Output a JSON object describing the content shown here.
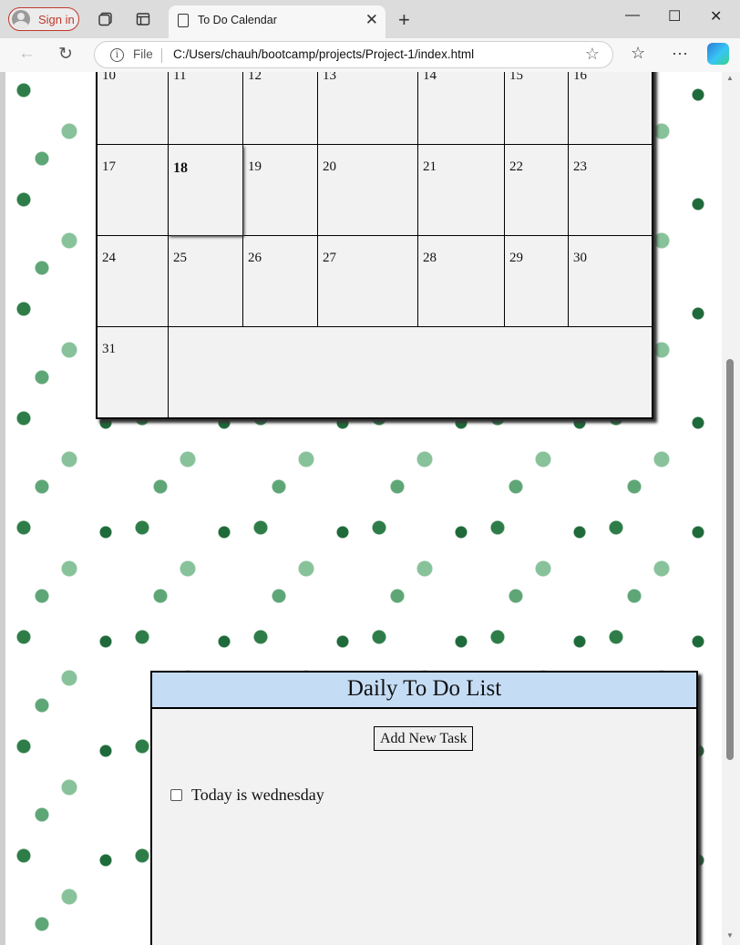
{
  "browser": {
    "sign_in_label": "Sign in",
    "tab_title": "To Do Calendar",
    "file_label": "File",
    "url": "C:/Users/chauh/bootcamp/projects/Project-1/index.html"
  },
  "calendar": {
    "rows": [
      [
        "10",
        "11",
        "12",
        "13",
        "14",
        "15",
        "16"
      ],
      [
        "17",
        "18",
        "19",
        "20",
        "21",
        "22",
        "23"
      ],
      [
        "24",
        "25",
        "26",
        "27",
        "28",
        "29",
        "30"
      ],
      [
        "31"
      ]
    ],
    "today": "18"
  },
  "todo": {
    "title": "Daily To Do List",
    "add_button_label": "Add New Task",
    "tasks": [
      {
        "label": "Today is wednesday",
        "checked": false
      }
    ]
  },
  "colors": {
    "todo_header_bg": "#c5dcf5",
    "calendar_bg": "#f3f2f2",
    "sign_in_accent": "#c0392b"
  }
}
